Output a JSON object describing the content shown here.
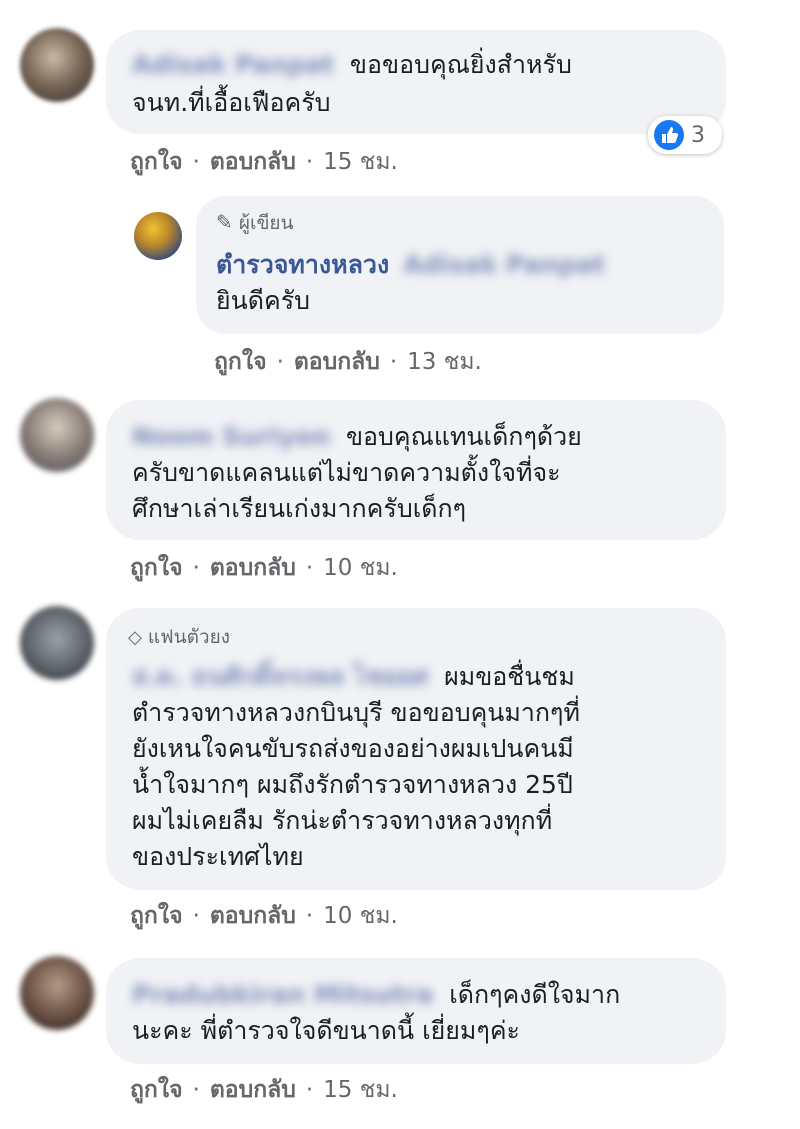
{
  "actions": {
    "like": "ถูกใจ",
    "reply": "ตอบกลับ",
    "separator": "·"
  },
  "comments": [
    {
      "author": "Adisak Panpat",
      "lines": [
        "ขอขอบคุณยิ่งสำหรับ",
        "จนท.ที่เอื้อเฟือครับ"
      ],
      "time": "15 ชม.",
      "reactions": {
        "icon": "like-icon",
        "count": "3"
      }
    },
    {
      "badge": "ผู้เขียน",
      "badge_icon": "pencil-icon",
      "author": "ตำรวจทางหลวง",
      "tagged": "Adisak Panpat",
      "lines": [
        "ยินดีครับ"
      ],
      "time": "13 ชม."
    },
    {
      "author": "Noom Suriyon",
      "lines": [
        "ขอบคุณแทนเด็กๆด้วย",
        "ครับขาดแคลนแต่ไม่ขาดความตั้งใจที่จะ",
        "ศึกษาเล่าเรียนเก่งมากครับเด็กๆ"
      ],
      "time": "10 ชม."
    },
    {
      "badge": "แฟนตัวยง",
      "badge_icon": "diamond-icon",
      "author": "ส.ต. ธนศักดิ์ทรงพล ไชยยศ",
      "lines": [
        "ผมขอชื่นชม",
        "ตำรวจทางหลวงกบินบุรี ขอขอบคุนมากๆที่",
        "ยังเหนใจคนขับรถส่งของอย่างผมเปนคนมี",
        "น้ำใจมากๆ ผมถึงรักตำรวจทางหลวง 25ปี",
        "ผมไม่เคยลืม รักน่ะตำรวจทางหลวงทุกที่",
        "ของประเทศไทย"
      ],
      "time": "10 ชม."
    },
    {
      "author": "Pradubkiran Mitsutra",
      "lines": [
        "เด็กๆคงดีใจมาก",
        "นะคะ พี่ตำรวจใจดีขนาดนี้ เยี่ยมๆค่ะ"
      ],
      "time": "15 ชม."
    }
  ],
  "colors": {
    "bubble": "#f0f2f5",
    "name": "#385898",
    "meta": "#65676b",
    "like_blue": "#1877f2"
  }
}
